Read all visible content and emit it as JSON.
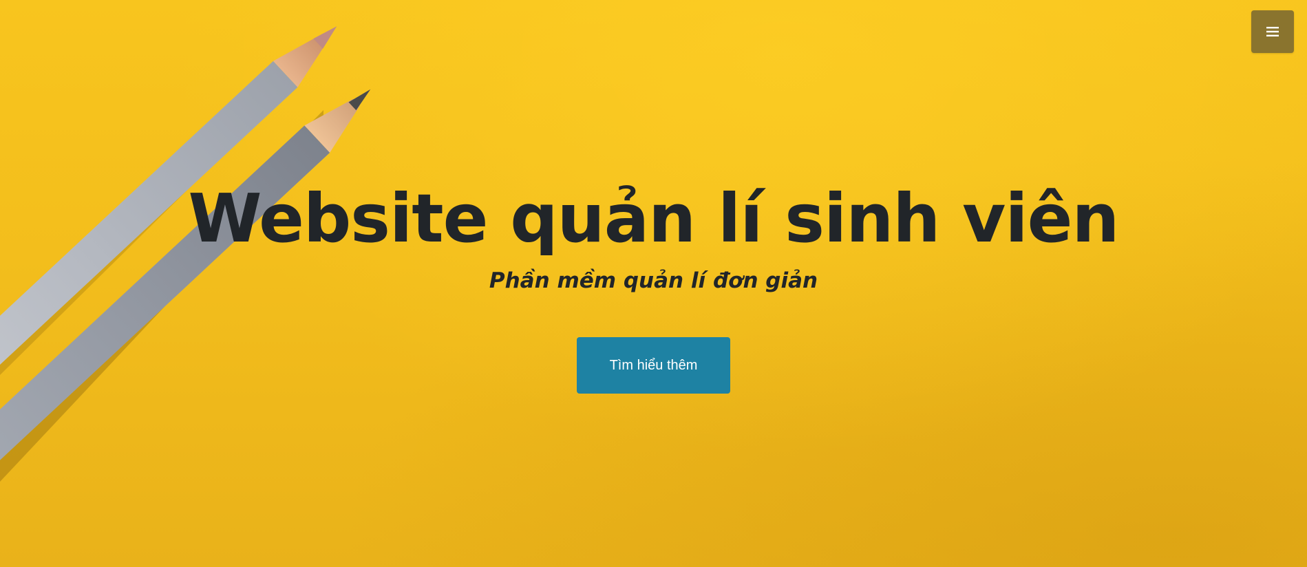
{
  "hero": {
    "title": "Website quản lí sinh viên",
    "subtitle": "Phần mềm quản lí đơn giản",
    "cta_label": "Tìm hiểu thêm",
    "background_color": "#f8c51e",
    "background_image": "yellow-paper-with-pencils"
  },
  "nav": {
    "menu_toggle_icon": "hamburger-menu-icon",
    "menu_toggle_color": "#8a742e"
  },
  "colors": {
    "text": "#212529",
    "button": "#1e82a3"
  }
}
